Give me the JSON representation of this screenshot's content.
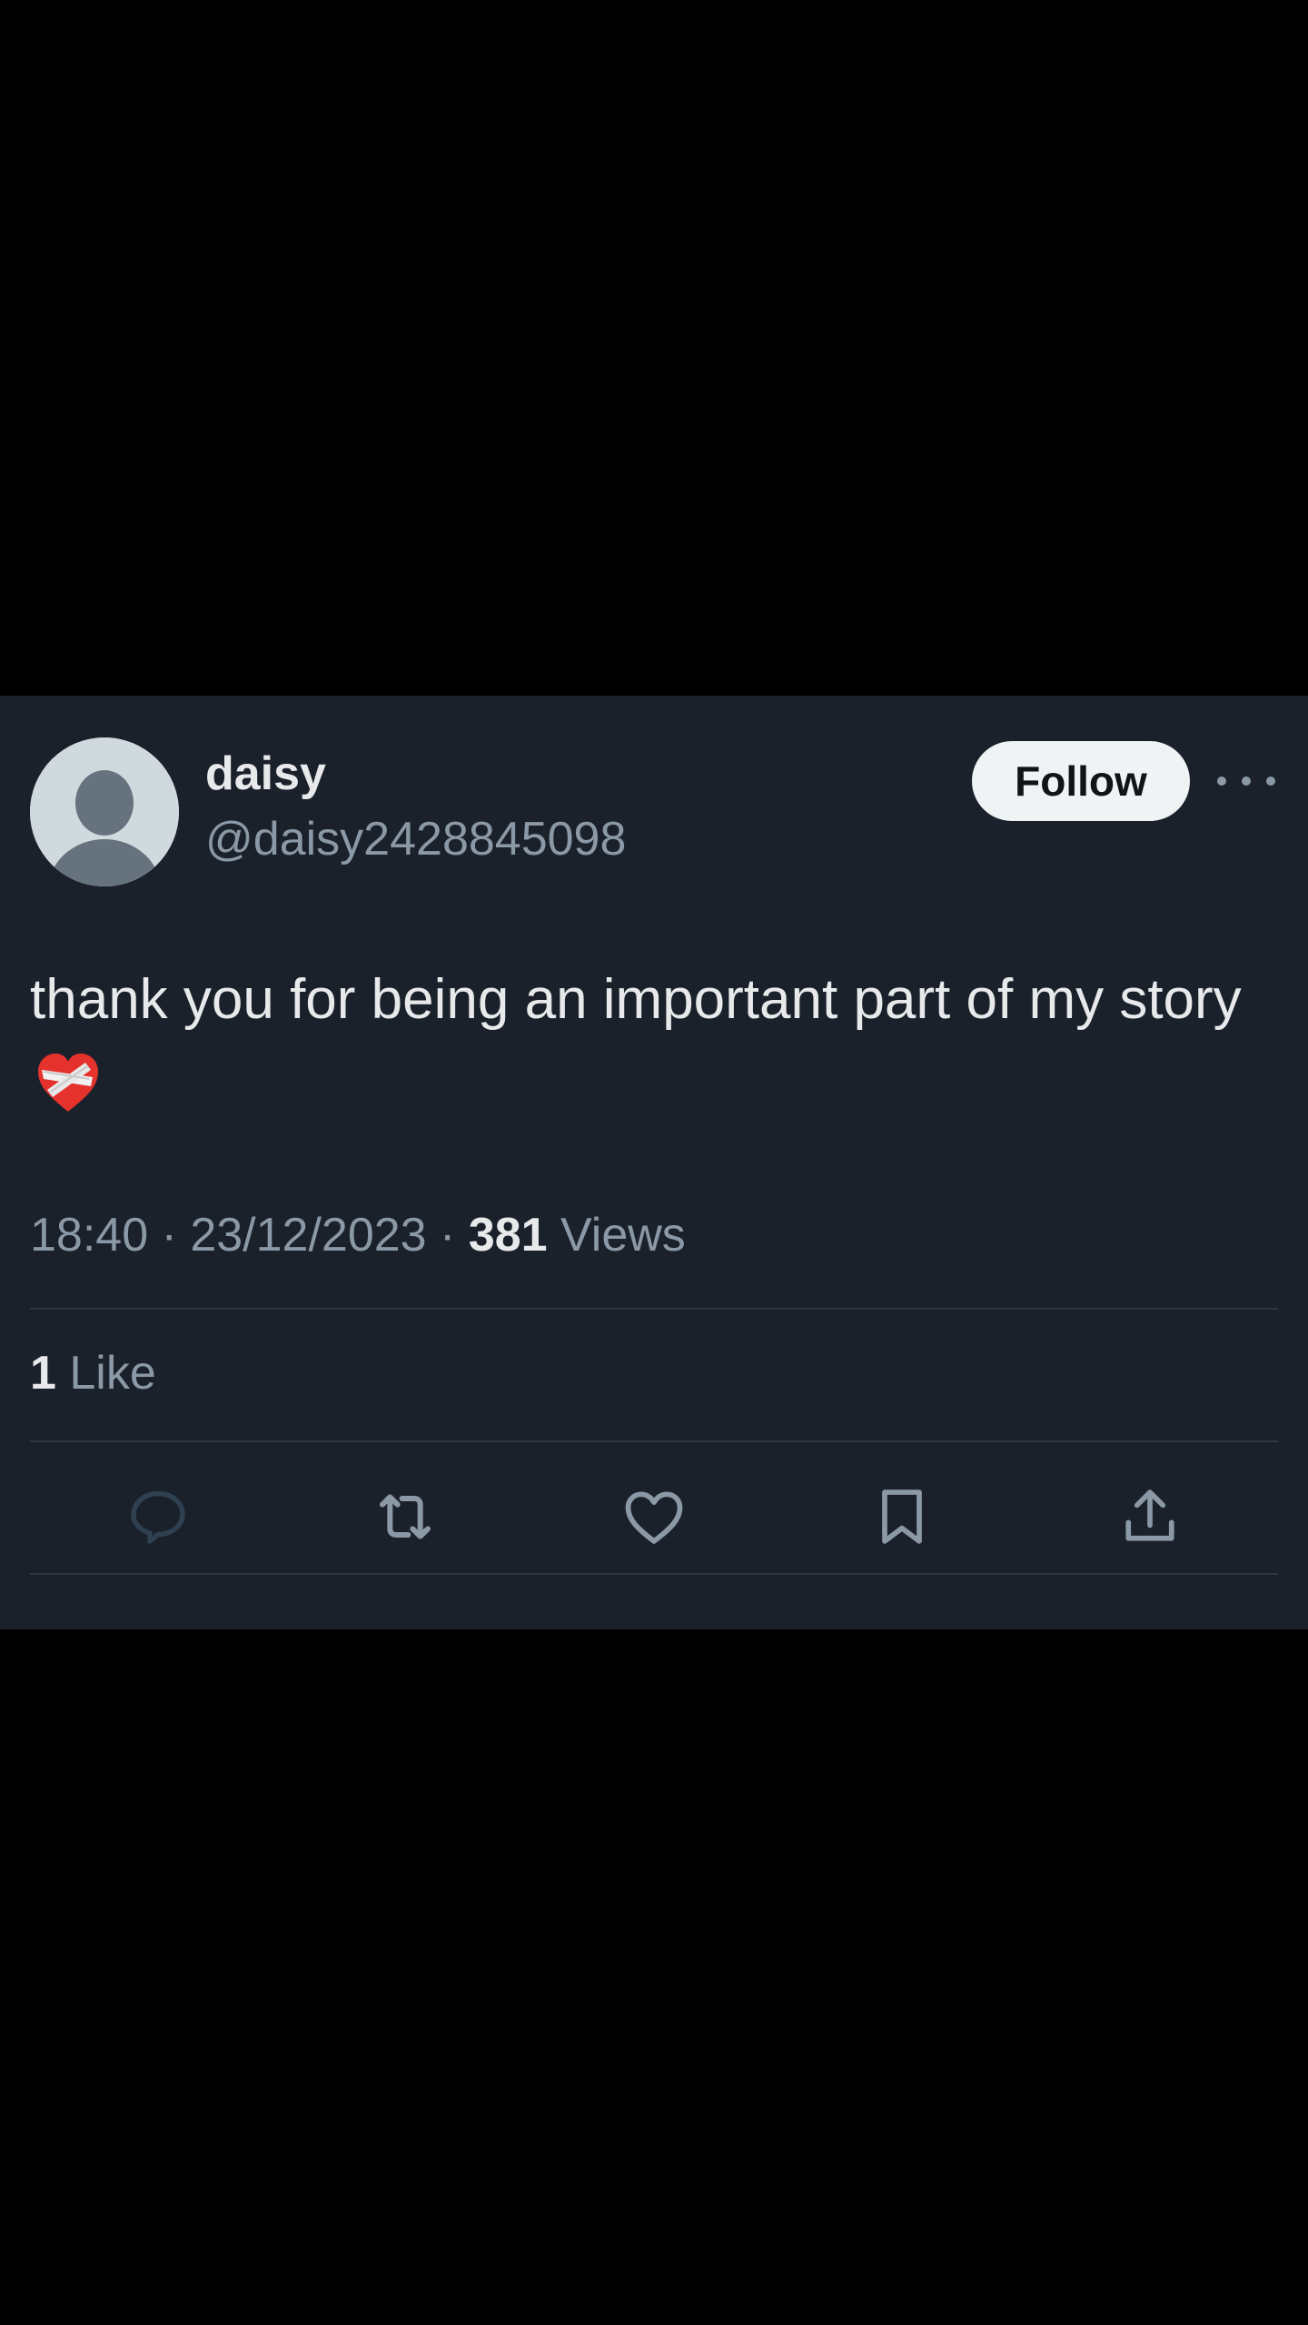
{
  "tweet": {
    "author": {
      "display_name": "daisy",
      "handle": "@daisy2428845098"
    },
    "follow_label": "Follow",
    "text": "thank you for being an important part of my story",
    "emoji": "mending-heart-emoji",
    "timestamp": "18:40 · 23/12/2023 · ",
    "views_count": "381",
    "views_label": " Views",
    "likes_count": "1",
    "likes_label": " Like"
  },
  "actions": [
    {
      "icon": "reply-icon",
      "color": "#2f4050"
    },
    {
      "icon": "retweet-icon",
      "color": "#8b98a5"
    },
    {
      "icon": "like-icon",
      "color": "#8b98a5"
    },
    {
      "icon": "bookmark-icon",
      "color": "#8b98a5"
    },
    {
      "icon": "share-icon",
      "color": "#8b98a5"
    }
  ],
  "colors": {
    "page_background": "#000000",
    "card_background": "#1b212b",
    "primary_text": "#e7e9ea",
    "secondary_text": "#8b98a5",
    "follow_button": "#eff3f4"
  }
}
